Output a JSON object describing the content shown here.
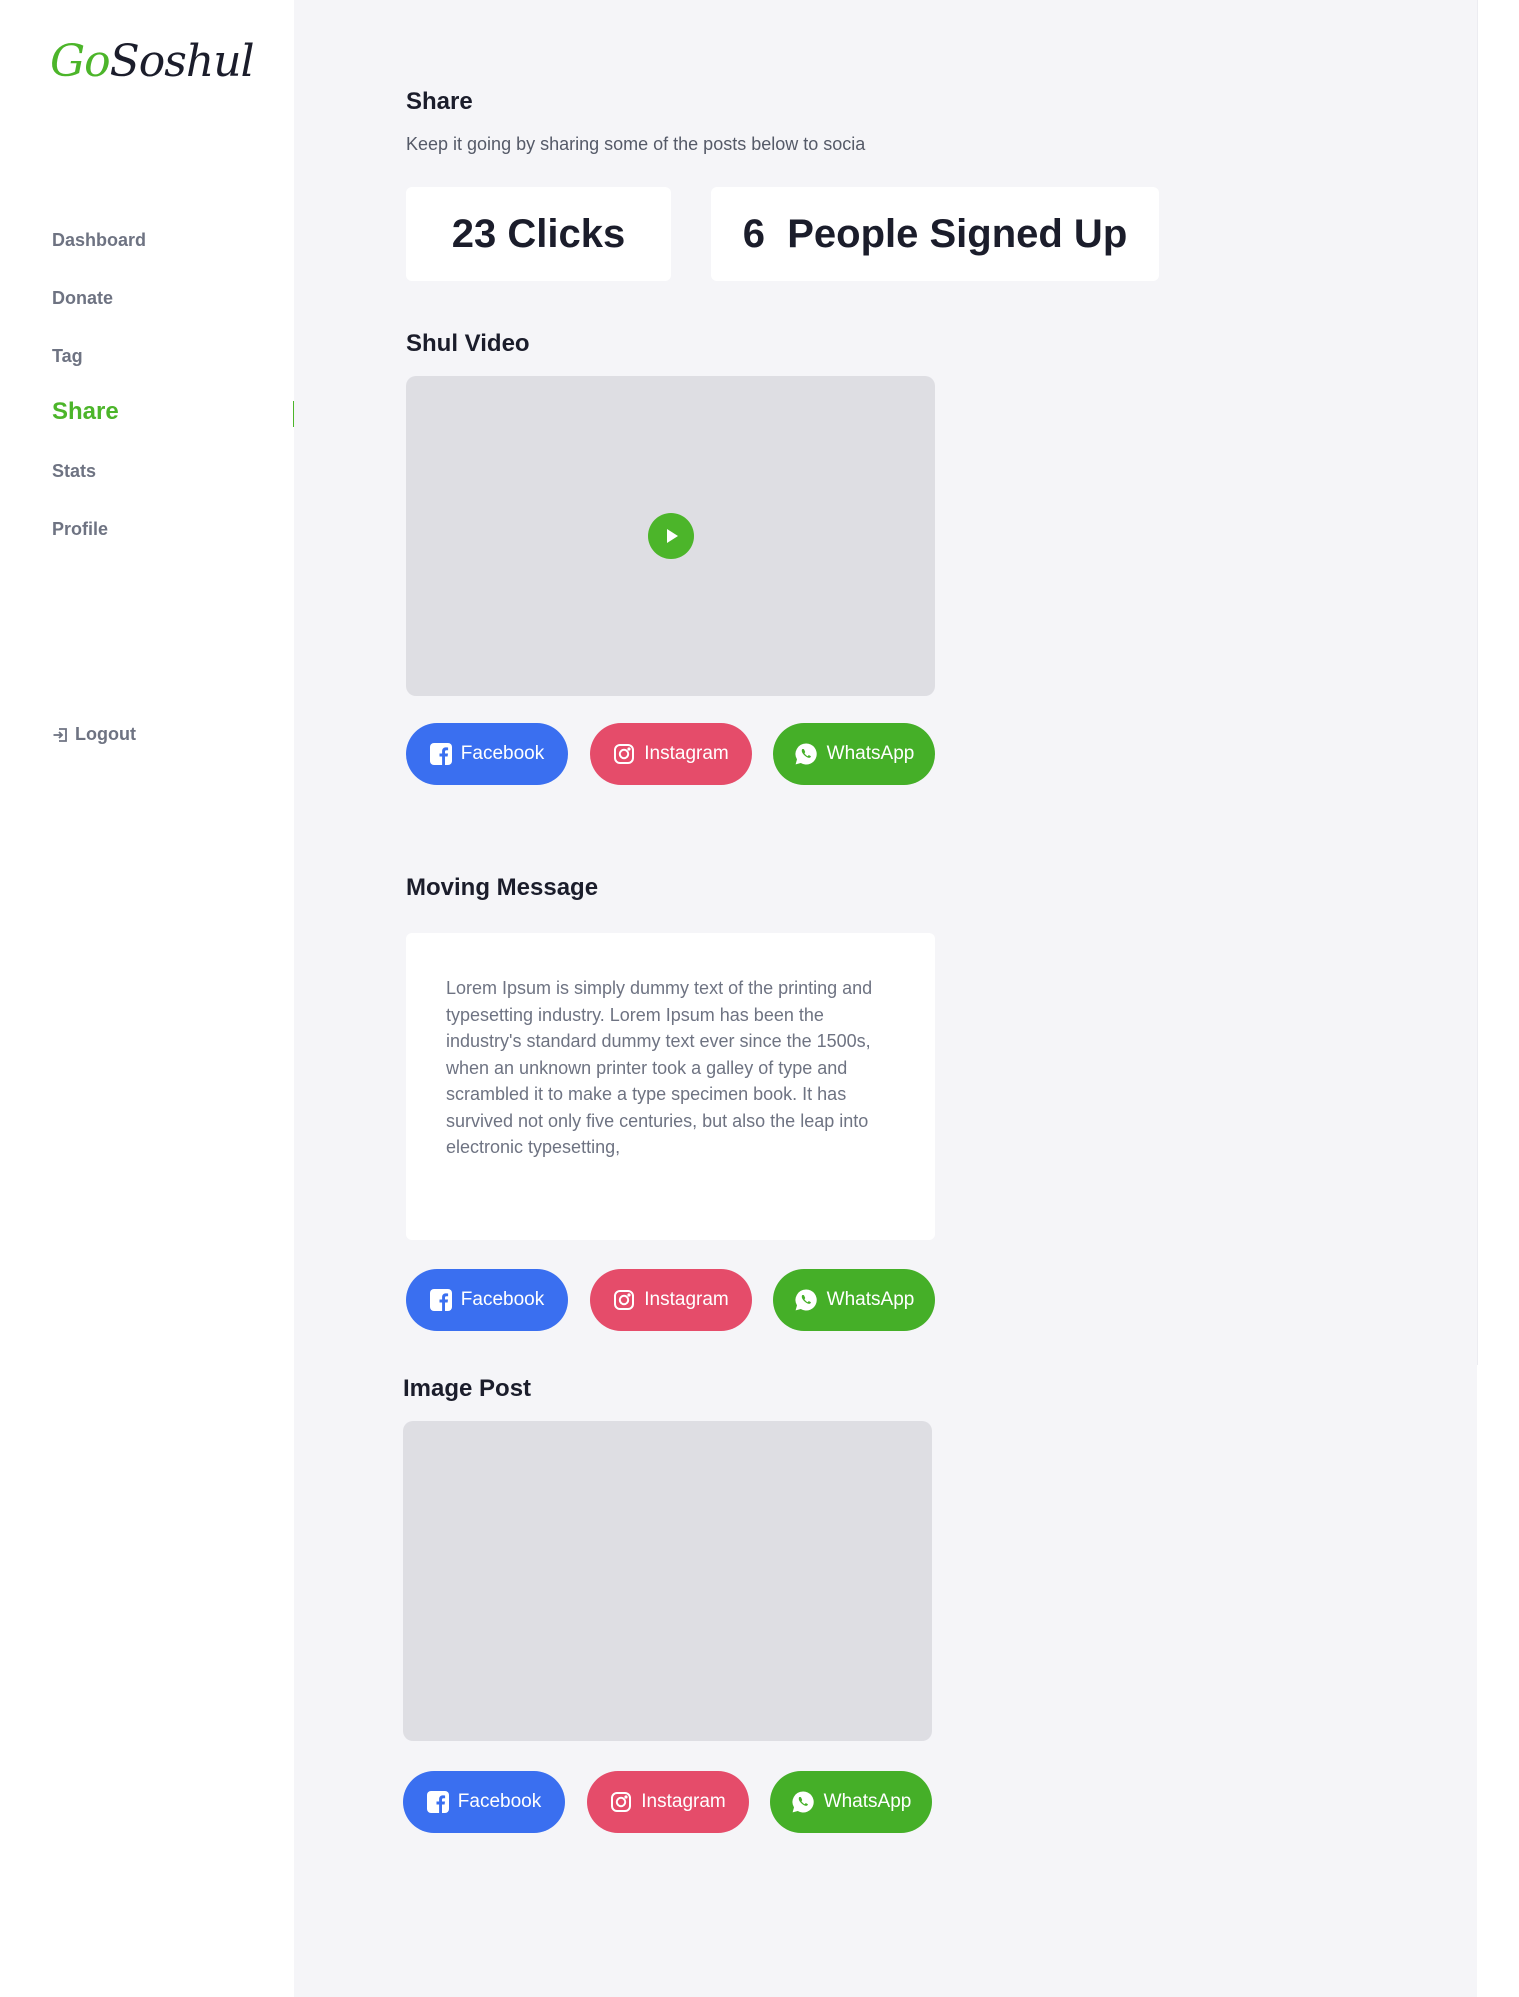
{
  "brand": {
    "logo_part1": "Go",
    "logo_part2": "Soshul",
    "accent_color": "#4cb52a"
  },
  "sidebar": {
    "items": [
      {
        "label": "Dashboard",
        "active": false
      },
      {
        "label": "Donate",
        "active": false
      },
      {
        "label": "Tag",
        "active": false
      },
      {
        "label": "Share",
        "active": true
      },
      {
        "label": "Stats",
        "active": false
      },
      {
        "label": "Profile",
        "active": false
      }
    ],
    "logout_label": "Logout",
    "logout_icon": "logout-icon"
  },
  "page": {
    "title": "Share",
    "subtitle": "Keep it going by sharing some of the posts below to socia"
  },
  "stats": {
    "clicks": "23 Clicks",
    "signups": "6  People Signed Up"
  },
  "sections": {
    "video": {
      "title": "Shul Video",
      "play_icon": "play-icon",
      "share": {
        "facebook": "Facebook",
        "instagram": "Instagram",
        "whatsapp": "WhatsApp"
      }
    },
    "message": {
      "title": "Moving Message",
      "body": "Lorem Ipsum is simply dummy text of the printing and typesetting industry. Lorem Ipsum has been the industry's standard dummy text ever since the 1500s, when an unknown printer took a galley of type and scrambled it to make a type specimen book. It has survived not only five centuries, but also the leap into electronic typesetting,",
      "share": {
        "facebook": "Facebook",
        "instagram": "Instagram",
        "whatsapp": "WhatsApp"
      }
    },
    "image": {
      "title": "Image Post",
      "share": {
        "facebook": "Facebook",
        "instagram": "Instagram",
        "whatsapp": "WhatsApp"
      }
    }
  },
  "colors": {
    "facebook": "#3a6ff0",
    "instagram": "#e54c6a",
    "whatsapp": "#45af28"
  }
}
